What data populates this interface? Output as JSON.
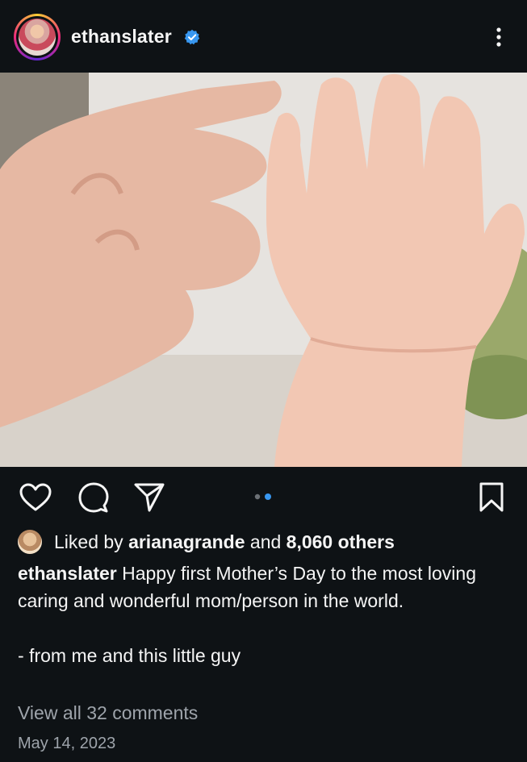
{
  "post": {
    "username": "ethanslater",
    "verified": true,
    "more_icon": "more-vertical-icon"
  },
  "media": {
    "description": "photo",
    "carousel_dots": 2,
    "active_dot": 2
  },
  "actions": {
    "like_icon": "heart-icon",
    "comment_icon": "comment-icon",
    "share_icon": "send-icon",
    "save_icon": "bookmark-icon"
  },
  "likes": {
    "prefix": "Liked by ",
    "user": "arianagrande",
    "middle": " and ",
    "count": "8,060 others"
  },
  "caption": {
    "username": "ethanslater",
    "text": " Happy first Mother’s Day to the most loving caring and wonderful mom/person in the world.\n\n- from me and this little guy"
  },
  "comments_link": "View all 32 comments",
  "date": "May 14, 2023",
  "colors": {
    "background": "#0e1215",
    "accent_dot": "#3897f0",
    "verified": "#3897f0",
    "muted_text": "#9ea4ab"
  }
}
